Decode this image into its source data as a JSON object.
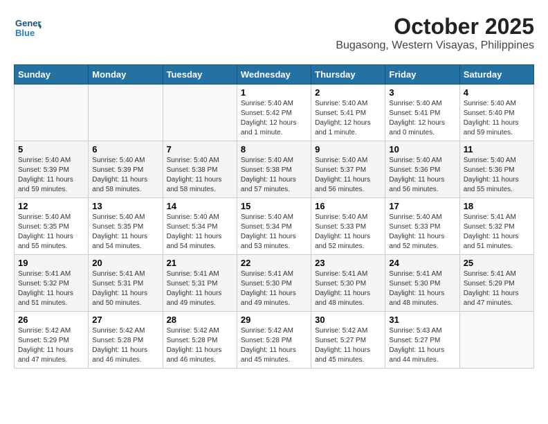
{
  "header": {
    "logo_line1": "General",
    "logo_line2": "Blue",
    "month": "October 2025",
    "location": "Bugasong, Western Visayas, Philippines"
  },
  "weekdays": [
    "Sunday",
    "Monday",
    "Tuesday",
    "Wednesday",
    "Thursday",
    "Friday",
    "Saturday"
  ],
  "weeks": [
    [
      {
        "day": "",
        "info": ""
      },
      {
        "day": "",
        "info": ""
      },
      {
        "day": "",
        "info": ""
      },
      {
        "day": "1",
        "info": "Sunrise: 5:40 AM\nSunset: 5:42 PM\nDaylight: 12 hours\nand 1 minute."
      },
      {
        "day": "2",
        "info": "Sunrise: 5:40 AM\nSunset: 5:41 PM\nDaylight: 12 hours\nand 1 minute."
      },
      {
        "day": "3",
        "info": "Sunrise: 5:40 AM\nSunset: 5:41 PM\nDaylight: 12 hours\nand 0 minutes."
      },
      {
        "day": "4",
        "info": "Sunrise: 5:40 AM\nSunset: 5:40 PM\nDaylight: 11 hours\nand 59 minutes."
      }
    ],
    [
      {
        "day": "5",
        "info": "Sunrise: 5:40 AM\nSunset: 5:39 PM\nDaylight: 11 hours\nand 59 minutes."
      },
      {
        "day": "6",
        "info": "Sunrise: 5:40 AM\nSunset: 5:39 PM\nDaylight: 11 hours\nand 58 minutes."
      },
      {
        "day": "7",
        "info": "Sunrise: 5:40 AM\nSunset: 5:38 PM\nDaylight: 11 hours\nand 58 minutes."
      },
      {
        "day": "8",
        "info": "Sunrise: 5:40 AM\nSunset: 5:38 PM\nDaylight: 11 hours\nand 57 minutes."
      },
      {
        "day": "9",
        "info": "Sunrise: 5:40 AM\nSunset: 5:37 PM\nDaylight: 11 hours\nand 56 minutes."
      },
      {
        "day": "10",
        "info": "Sunrise: 5:40 AM\nSunset: 5:36 PM\nDaylight: 11 hours\nand 56 minutes."
      },
      {
        "day": "11",
        "info": "Sunrise: 5:40 AM\nSunset: 5:36 PM\nDaylight: 11 hours\nand 55 minutes."
      }
    ],
    [
      {
        "day": "12",
        "info": "Sunrise: 5:40 AM\nSunset: 5:35 PM\nDaylight: 11 hours\nand 55 minutes."
      },
      {
        "day": "13",
        "info": "Sunrise: 5:40 AM\nSunset: 5:35 PM\nDaylight: 11 hours\nand 54 minutes."
      },
      {
        "day": "14",
        "info": "Sunrise: 5:40 AM\nSunset: 5:34 PM\nDaylight: 11 hours\nand 54 minutes."
      },
      {
        "day": "15",
        "info": "Sunrise: 5:40 AM\nSunset: 5:34 PM\nDaylight: 11 hours\nand 53 minutes."
      },
      {
        "day": "16",
        "info": "Sunrise: 5:40 AM\nSunset: 5:33 PM\nDaylight: 11 hours\nand 52 minutes."
      },
      {
        "day": "17",
        "info": "Sunrise: 5:40 AM\nSunset: 5:33 PM\nDaylight: 11 hours\nand 52 minutes."
      },
      {
        "day": "18",
        "info": "Sunrise: 5:41 AM\nSunset: 5:32 PM\nDaylight: 11 hours\nand 51 minutes."
      }
    ],
    [
      {
        "day": "19",
        "info": "Sunrise: 5:41 AM\nSunset: 5:32 PM\nDaylight: 11 hours\nand 51 minutes."
      },
      {
        "day": "20",
        "info": "Sunrise: 5:41 AM\nSunset: 5:31 PM\nDaylight: 11 hours\nand 50 minutes."
      },
      {
        "day": "21",
        "info": "Sunrise: 5:41 AM\nSunset: 5:31 PM\nDaylight: 11 hours\nand 49 minutes."
      },
      {
        "day": "22",
        "info": "Sunrise: 5:41 AM\nSunset: 5:30 PM\nDaylight: 11 hours\nand 49 minutes."
      },
      {
        "day": "23",
        "info": "Sunrise: 5:41 AM\nSunset: 5:30 PM\nDaylight: 11 hours\nand 48 minutes."
      },
      {
        "day": "24",
        "info": "Sunrise: 5:41 AM\nSunset: 5:30 PM\nDaylight: 11 hours\nand 48 minutes."
      },
      {
        "day": "25",
        "info": "Sunrise: 5:41 AM\nSunset: 5:29 PM\nDaylight: 11 hours\nand 47 minutes."
      }
    ],
    [
      {
        "day": "26",
        "info": "Sunrise: 5:42 AM\nSunset: 5:29 PM\nDaylight: 11 hours\nand 47 minutes."
      },
      {
        "day": "27",
        "info": "Sunrise: 5:42 AM\nSunset: 5:28 PM\nDaylight: 11 hours\nand 46 minutes."
      },
      {
        "day": "28",
        "info": "Sunrise: 5:42 AM\nSunset: 5:28 PM\nDaylight: 11 hours\nand 46 minutes."
      },
      {
        "day": "29",
        "info": "Sunrise: 5:42 AM\nSunset: 5:28 PM\nDaylight: 11 hours\nand 45 minutes."
      },
      {
        "day": "30",
        "info": "Sunrise: 5:42 AM\nSunset: 5:27 PM\nDaylight: 11 hours\nand 45 minutes."
      },
      {
        "day": "31",
        "info": "Sunrise: 5:43 AM\nSunset: 5:27 PM\nDaylight: 11 hours\nand 44 minutes."
      },
      {
        "day": "",
        "info": ""
      }
    ]
  ]
}
